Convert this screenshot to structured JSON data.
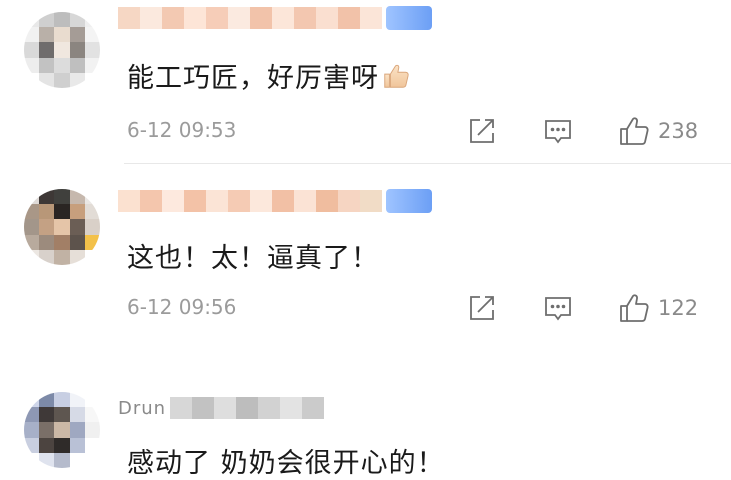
{
  "comments": [
    {
      "username": "",
      "text": "能工巧匠，好厉害呀",
      "emoji": "thumbs-up-emoji",
      "time": "6-12 09:53",
      "likes": "238",
      "badge": "",
      "avatar_colors": [
        "#e8e8e8",
        "#cfcfcf",
        "#bdbdbd",
        "#d7d7d7",
        "#efefef",
        "#f1f1f1",
        "#b9b0a8",
        "#e9dccf",
        "#a59c96",
        "#f4f4f4",
        "#d9d9d9",
        "#6f6c6c",
        "#f0e7df",
        "#8b8580",
        "#e2e2e2",
        "#ededed",
        "#c2c2c2",
        "#dcdcdc",
        "#bfbfbf",
        "#f2f2f2",
        "#ffffff",
        "#e4e4e4",
        "#cfcfcf",
        "#e9e9e9",
        "#ffffff"
      ]
    },
    {
      "username": "",
      "text": "这也！太！逼真了！",
      "time": "6-12 09:56",
      "likes": "122",
      "badge": "",
      "avatar_colors": [
        "#dfdad7",
        "#3e3836",
        "#40403d",
        "#c6b8ad",
        "#eae7e4",
        "#a99787",
        "#b89778",
        "#2a2523",
        "#c79f7d",
        "#e2dcd6",
        "#a3968a",
        "#c4a184",
        "#e5c5a8",
        "#6b5e55",
        "#d9d0c8",
        "#b8aa9d",
        "#9c8b7d",
        "#a27f66",
        "#5d534c",
        "#f3c14a",
        "#ece7e2",
        "#d8d1cb",
        "#c1b2a4",
        "#e6dfd8",
        "#ffffff"
      ]
    },
    {
      "username": "Drun",
      "text": "感动了 奶奶会很开心的！",
      "avatar_colors": [
        "#cfd6ea",
        "#7d8aa8",
        "#c8cfe3",
        "#f1f3f8",
        "#ffffff",
        "#8e98b4",
        "#3f3938",
        "#5e5650",
        "#d6dae6",
        "#f7f7f7",
        "#a7b0c8",
        "#7a6f68",
        "#cbb8a6",
        "#9fa8c1",
        "#f0f0f0",
        "#c9cfe0",
        "#4c4440",
        "#2f2b29",
        "#b9c1d6",
        "#ffffff",
        "#ffffff",
        "#dfe3ee",
        "#b5bbcc",
        "#ffffff",
        "#ffffff"
      ]
    }
  ],
  "colors": {
    "text": "#1a1a1a",
    "meta": "#9b9b9b",
    "icon": "#6e6e6e",
    "divider": "#e8e8e8",
    "badge": "#6c9ff5"
  },
  "icons": [
    "share-icon",
    "reply-icon",
    "thumbs-up-outline-icon"
  ]
}
